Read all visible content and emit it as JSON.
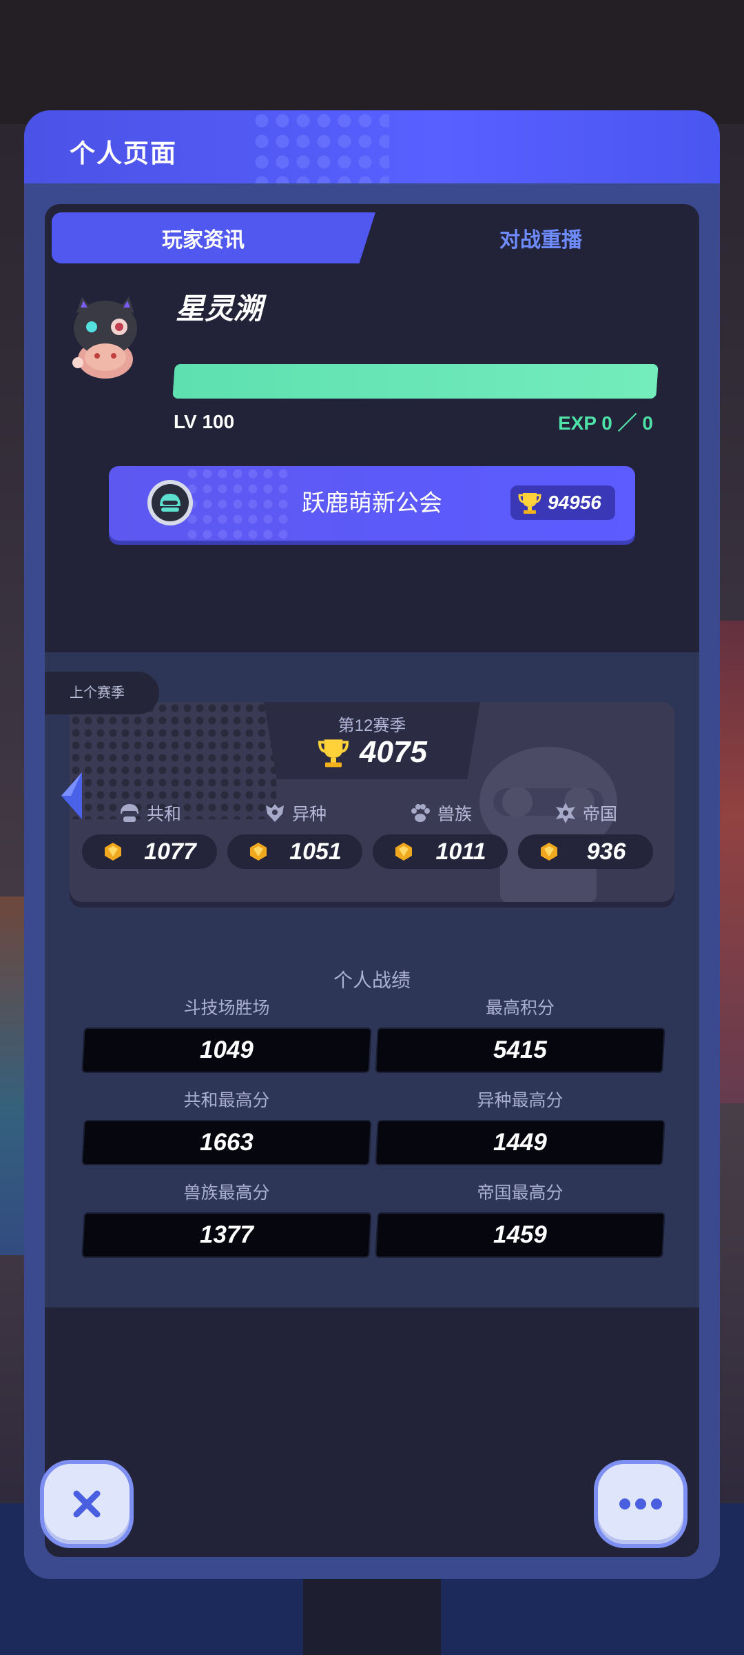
{
  "modal": {
    "title": "个人页面"
  },
  "tabs": [
    {
      "label": "玩家资讯",
      "active": true
    },
    {
      "label": "对战重播",
      "active": false
    }
  ],
  "player": {
    "name": "星灵溯",
    "level": "LV 100",
    "exp": "EXP 0 ／ 0",
    "exp_progress": 1.0
  },
  "guild": {
    "name": "跃鹿萌新公会",
    "trophies": "94956",
    "badge_icon": "guild-badge-icon"
  },
  "season": {
    "prev_label": "上个赛季",
    "season_label": "第12赛季",
    "score": "4075",
    "factions": [
      {
        "name": "共和",
        "score": "1077",
        "icon": "republic-icon"
      },
      {
        "name": "异种",
        "score": "1051",
        "icon": "xeno-icon"
      },
      {
        "name": "兽族",
        "score": "1011",
        "icon": "beast-paw-icon"
      },
      {
        "name": "帝国",
        "score": "936",
        "icon": "empire-icon"
      }
    ]
  },
  "stats": {
    "title": "个人战绩",
    "items": [
      {
        "label": "斗技场胜场",
        "value": "1049"
      },
      {
        "label": "最高积分",
        "value": "5415"
      },
      {
        "label": "共和最高分",
        "value": "1663"
      },
      {
        "label": "异种最高分",
        "value": "1449"
      },
      {
        "label": "兽族最高分",
        "value": "1377"
      },
      {
        "label": "帝国最高分",
        "value": "1459"
      }
    ]
  },
  "colors": {
    "accent": "#5158f0",
    "exp_green": "#4fe2a8",
    "tab_inactive": "#6f8cff",
    "panel": "#222238"
  }
}
